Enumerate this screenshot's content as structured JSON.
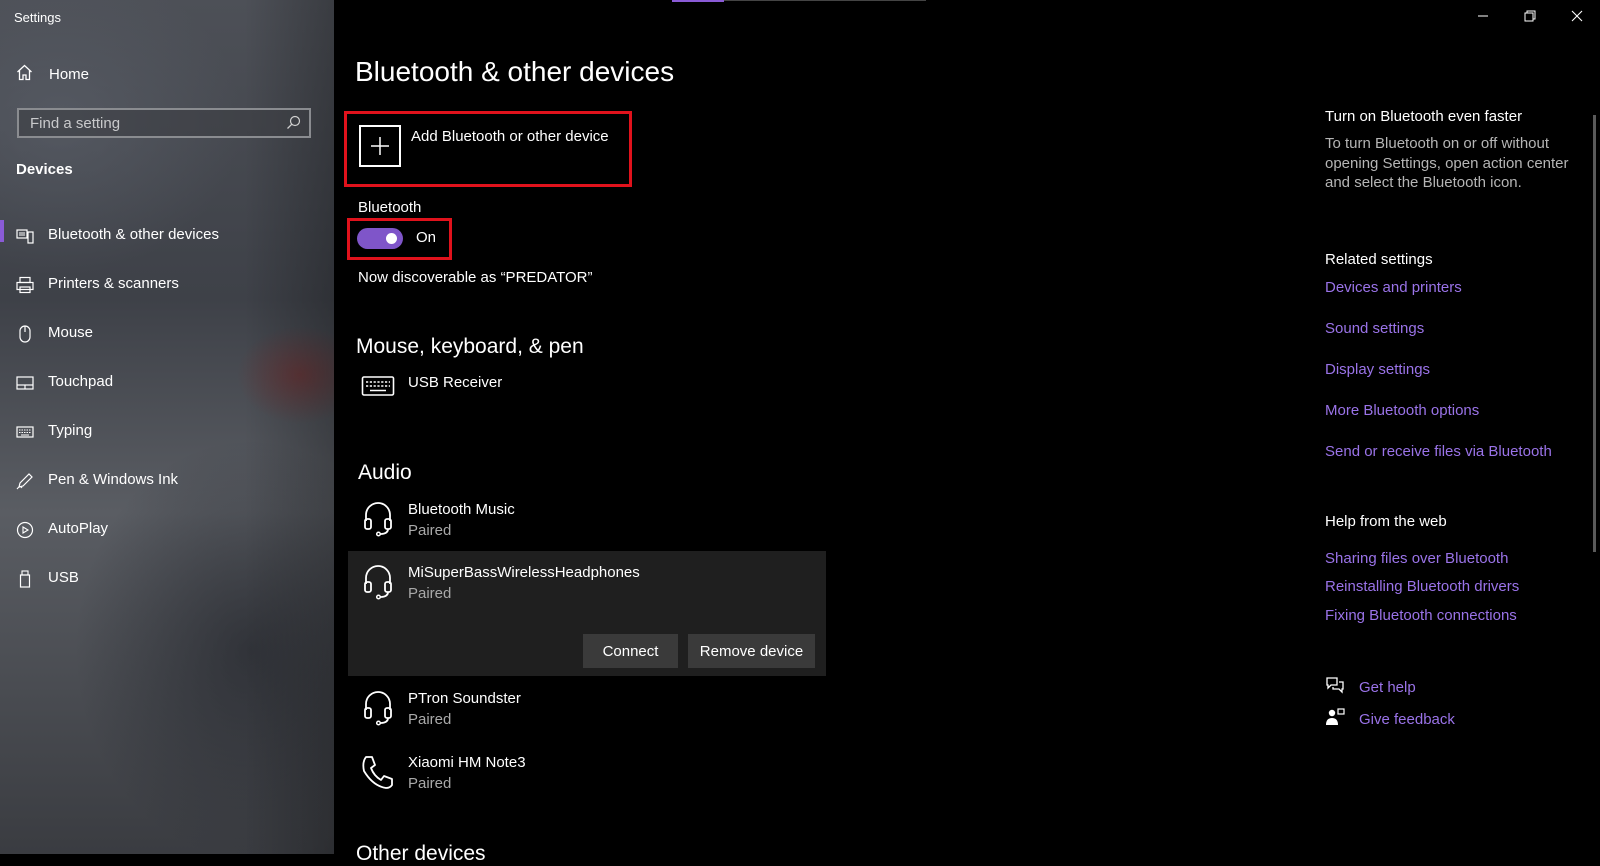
{
  "window": {
    "app_title": "Settings",
    "controls": [
      "minimize",
      "restore",
      "close"
    ]
  },
  "sidebar": {
    "home_label": "Home",
    "search_placeholder": "Find a setting",
    "section": "Devices",
    "items": [
      {
        "label": "Bluetooth & other devices",
        "icon": "bluetooth-devices-icon",
        "active": true
      },
      {
        "label": "Printers & scanners",
        "icon": "printer-icon"
      },
      {
        "label": "Mouse",
        "icon": "mouse-icon"
      },
      {
        "label": "Touchpad",
        "icon": "touchpad-icon"
      },
      {
        "label": "Typing",
        "icon": "keyboard-icon"
      },
      {
        "label": "Pen & Windows Ink",
        "icon": "pen-icon"
      },
      {
        "label": "AutoPlay",
        "icon": "autoplay-icon"
      },
      {
        "label": "USB",
        "icon": "usb-icon"
      }
    ]
  },
  "main": {
    "title": "Bluetooth & other devices",
    "add_device_label": "Add Bluetooth or other device",
    "bluetooth_label": "Bluetooth",
    "bluetooth_state": "On",
    "discoverable_text": "Now discoverable as “PREDATOR”",
    "mouse_section": {
      "title": "Mouse, keyboard, & pen",
      "devices": [
        {
          "name": "USB Receiver",
          "icon": "keyboard-icon"
        }
      ]
    },
    "audio_section": {
      "title": "Audio",
      "devices": [
        {
          "name": "Bluetooth Music",
          "status": "Paired",
          "icon": "headset-icon"
        },
        {
          "name": "MiSuperBassWirelessHeadphones",
          "status": "Paired",
          "icon": "headset-icon",
          "expanded": true
        },
        {
          "name": "PTron Soundster",
          "status": "Paired",
          "icon": "headset-icon"
        },
        {
          "name": "Xiaomi HM Note3",
          "status": "Paired",
          "icon": "phone-icon"
        }
      ]
    },
    "connect_label": "Connect",
    "remove_label": "Remove device",
    "other_section_title": "Other devices"
  },
  "right": {
    "tip_title": "Turn on Bluetooth even faster",
    "tip_text": "To turn Bluetooth on or off without opening Settings, open action center and select the Bluetooth icon.",
    "related_title": "Related settings",
    "related_links": [
      "Devices and printers",
      "Sound settings",
      "Display settings",
      "More Bluetooth options",
      "Send or receive files via Bluetooth"
    ],
    "help_title": "Help from the web",
    "help_links": [
      "Sharing files over Bluetooth",
      "Reinstalling Bluetooth drivers",
      "Fixing Bluetooth connections"
    ],
    "get_help": "Get help",
    "give_feedback": "Give feedback"
  },
  "colors": {
    "accent": "#8a5bd6",
    "link": "#9a73e8",
    "highlight_box": "#e0121c",
    "background": "#000000"
  }
}
